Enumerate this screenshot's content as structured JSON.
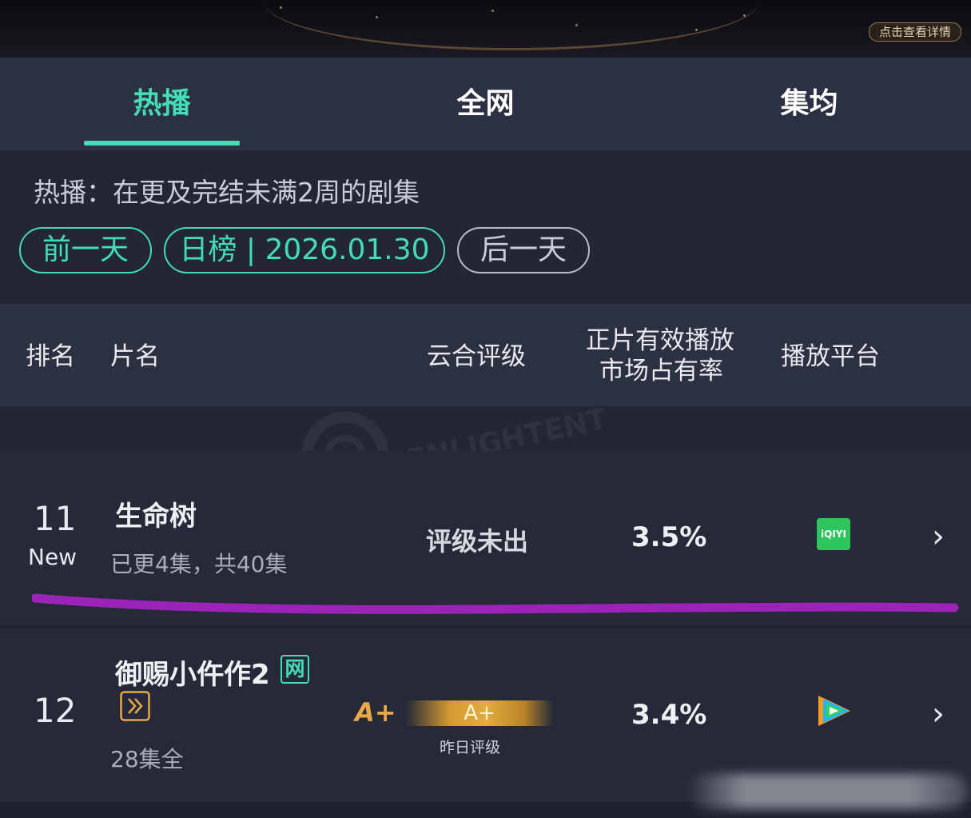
{
  "banner": {
    "detail_button": "点击查看详情"
  },
  "tabs": [
    {
      "label": "热播",
      "active": true
    },
    {
      "label": "全网",
      "active": false
    },
    {
      "label": "集均",
      "active": false
    }
  ],
  "filter": {
    "description": "热播：在更及完结未满2周的剧集",
    "prev_day": "前一天",
    "current": "日榜 | 2026.01.30",
    "next_day": "后一天"
  },
  "table": {
    "headers": {
      "rank": "排名",
      "title": "片名",
      "rating": "云合评级",
      "share_line1": "正片有效播放",
      "share_line2": "市场占有率",
      "platform": "播放平台"
    },
    "rows": [
      {
        "rank": "11",
        "new_tag": "New",
        "title": "生命树",
        "episodes": "已更4集，共40集",
        "rating": "评级未出",
        "share": "3.5%",
        "platform_icon": "iqiyi-icon",
        "platform_text": "iQIYI"
      },
      {
        "rank": "12",
        "title": "御赐小仵作2",
        "badge": "网",
        "episodes": "28集全",
        "rating": "A+",
        "rating_bar": "A+",
        "rating_note": "昨日评级",
        "share": "3.4%",
        "platform_icon": "tencent-video-icon"
      }
    ]
  },
  "colors": {
    "accent": "#43dcb4",
    "annotation": "#9b23b8",
    "grade_gold": "#e2ac3e"
  },
  "watermark": {
    "text": "ENLIGHTENT"
  }
}
